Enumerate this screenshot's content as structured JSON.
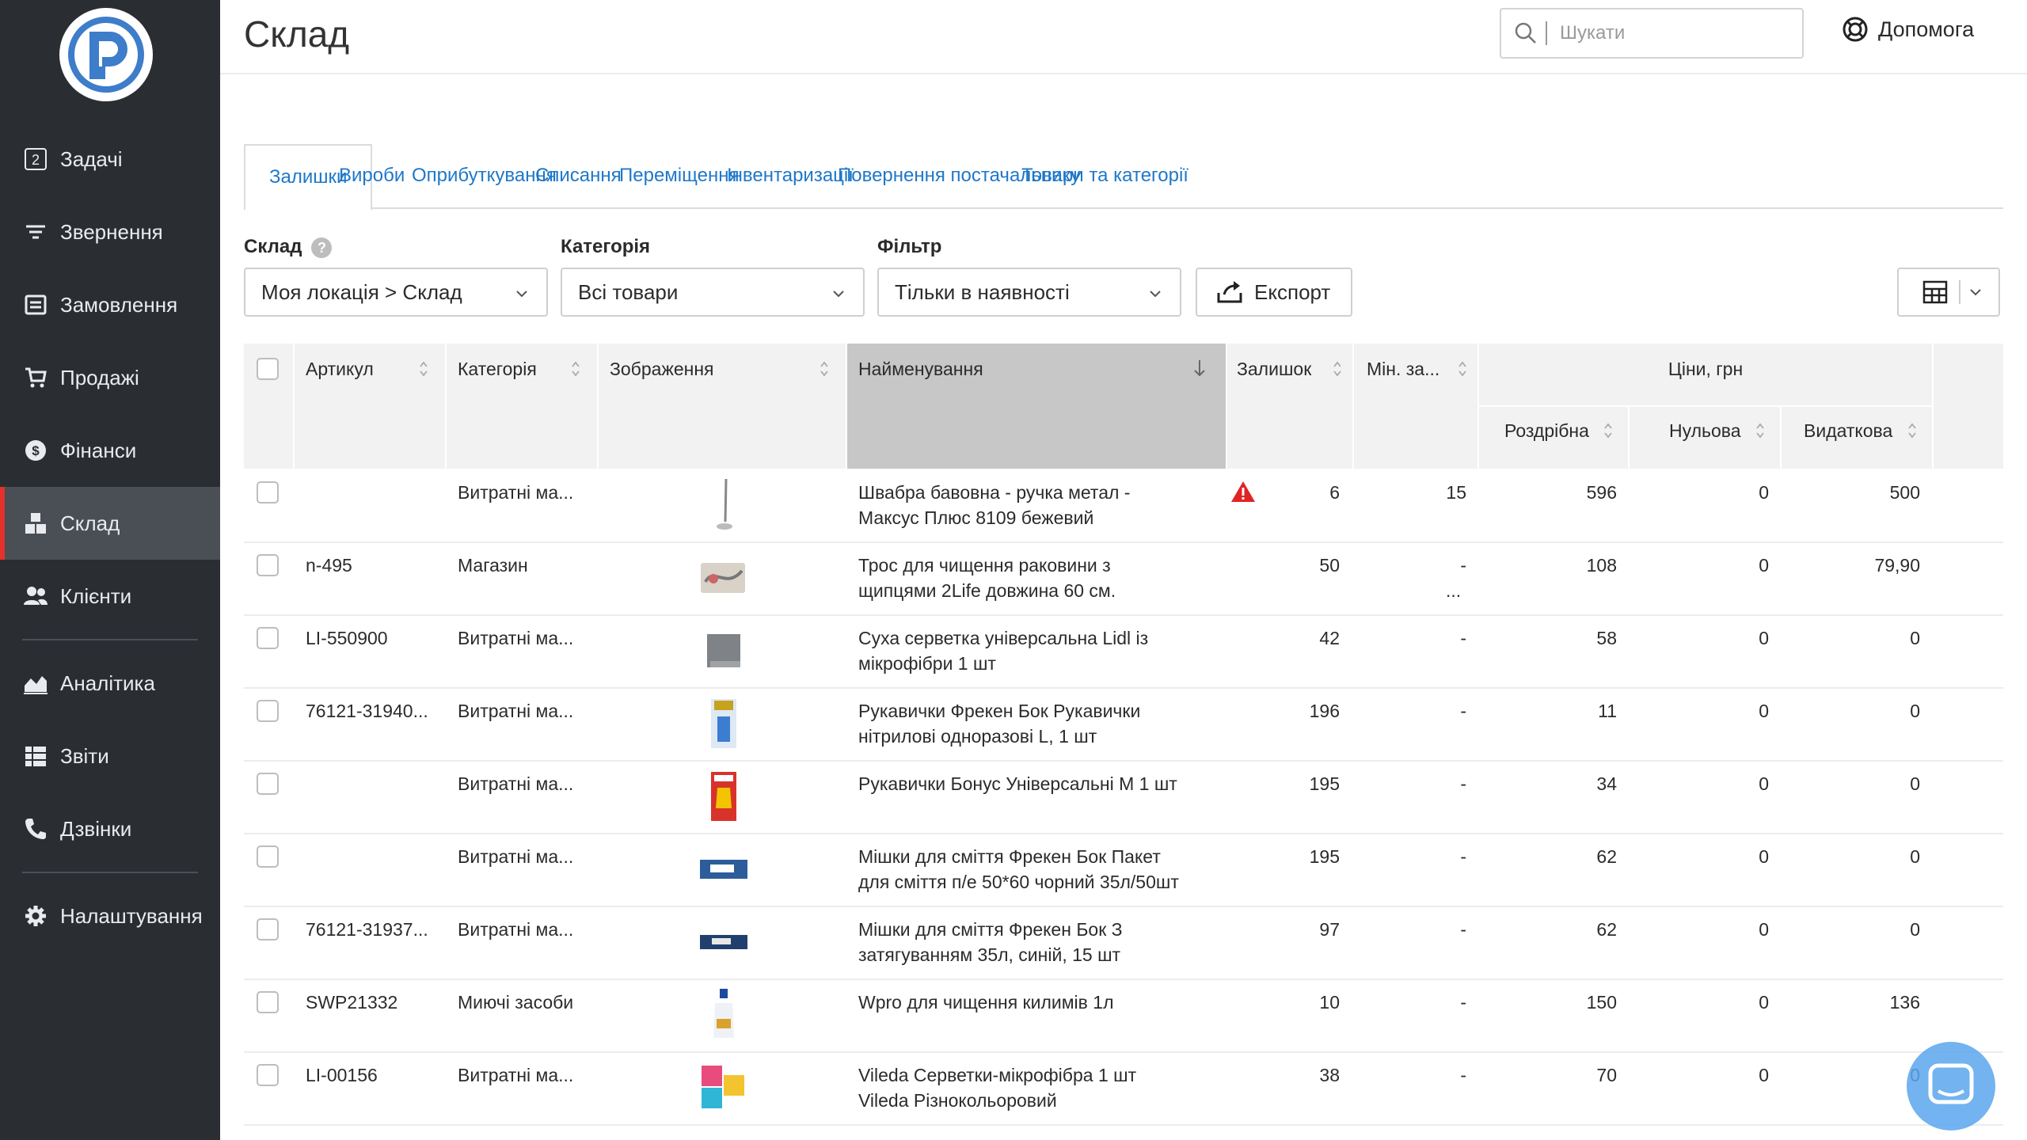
{
  "sidebar": {
    "items": [
      {
        "label": "Задачі",
        "icon": "tasks-badge-icon",
        "badge": "2"
      },
      {
        "label": "Звернення",
        "icon": "filter-lines-icon"
      },
      {
        "label": "Замовлення",
        "icon": "order-box-icon"
      },
      {
        "label": "Продажі",
        "icon": "cart-icon"
      },
      {
        "label": "Фінанси",
        "icon": "dollar-coin-icon"
      },
      {
        "label": "Склад",
        "icon": "warehouse-boxes-icon",
        "active": true
      },
      {
        "label": "Клієнти",
        "icon": "users-icon"
      },
      {
        "label": "Аналітика",
        "icon": "area-chart-icon"
      },
      {
        "label": "Звіти",
        "icon": "report-list-icon"
      },
      {
        "label": "Дзвінки",
        "icon": "phone-icon"
      },
      {
        "label": "Налаштування",
        "icon": "gear-icon"
      }
    ]
  },
  "header": {
    "title": "Склад",
    "search_placeholder": "Шукати",
    "help_label": "Допомога"
  },
  "tabs": [
    "Залишки",
    "Вироби",
    "Оприбуткування",
    "Списання",
    "Переміщення",
    "Інвентаризації",
    "Повернення постачальнику",
    "Товари та категорії"
  ],
  "filters": {
    "warehouse_label": "Склад",
    "warehouse_help": "?",
    "warehouse_value": "Моя локація > Склад",
    "category_label": "Категорія",
    "category_value": "Всі товари",
    "filter_label": "Фільтр",
    "filter_value": "Тільки в наявності",
    "export_label": "Експорт"
  },
  "table": {
    "headers": {
      "sku": "Артикул",
      "category": "Категорія",
      "image": "Зображення",
      "name": "Найменування",
      "stock": "Залишок",
      "min": "Мін. за...",
      "prices": "Ціни, грн",
      "retail": "Роздрібна",
      "zero": "Нульова",
      "expense": "Видаткова"
    },
    "rows": [
      {
        "sku": "",
        "category": "Витратні ма...",
        "name1": "Швабра бавовна - ручка метал -",
        "name2": "Максус Плюс 8109 бежевий",
        "stock": "6",
        "min": "15",
        "retail": "596",
        "zero": "0",
        "expense": "500",
        "warn": true,
        "img": "mop"
      },
      {
        "sku": "n-495",
        "category": "Магазин",
        "name1": "Трос для чищення раковини з",
        "name2": "щипцями 2Life довжина 60 см.",
        "more": "...",
        "stock": "50",
        "min": "-",
        "retail": "108",
        "zero": "0",
        "expense": "79,90",
        "img": "cable"
      },
      {
        "sku": "LI-550900",
        "category": "Витратні ма...",
        "name1": "Суха серветка універсальна Lidl із",
        "name2": "мікрофібри 1 шт",
        "stock": "42",
        "min": "-",
        "retail": "58",
        "zero": "0",
        "expense": "0",
        "img": "cloth"
      },
      {
        "sku": "76121-31940...",
        "category": "Витратні ма...",
        "name1": "Рукавички Фрекен Бок Рукавички",
        "name2": "нітрилові одноразові L, 1 шт",
        "stock": "196",
        "min": "-",
        "retail": "11",
        "zero": "0",
        "expense": "0",
        "img": "gloves-blue"
      },
      {
        "sku": "",
        "category": "Витратні ма...",
        "name1": "Рукавички Бонус Універсальні М 1 шт",
        "name2": "",
        "stock": "195",
        "min": "-",
        "retail": "34",
        "zero": "0",
        "expense": "0",
        "img": "gloves-red"
      },
      {
        "sku": "",
        "category": "Витратні ма...",
        "name1": "Мішки для сміття Фрекен Бок Пакет",
        "name2": "для сміття п/е 50*60 чорний 35л/50шт",
        "stock": "195",
        "min": "-",
        "retail": "62",
        "zero": "0",
        "expense": "0",
        "img": "bags"
      },
      {
        "sku": "76121-31937...",
        "category": "Витратні ма...",
        "name1": "Мішки для сміття Фрекен Бок З",
        "name2": "затягуванням 35л, синій, 15 шт",
        "stock": "97",
        "min": "-",
        "retail": "62",
        "zero": "0",
        "expense": "0",
        "img": "bags2"
      },
      {
        "sku": "SWP21332",
        "category": "Миючі засоби",
        "name1": "Wpro для чищення килимів 1л",
        "name2": "",
        "stock": "10",
        "min": "-",
        "retail": "150",
        "zero": "0",
        "expense": "136",
        "img": "bottle"
      },
      {
        "sku": "LI-00156",
        "category": "Витратні ма...",
        "name1": "Vileda Серветки-мікрофібра 1 шт",
        "name2": "Vileda Різнокольоровий",
        "stock": "38",
        "min": "-",
        "retail": "70",
        "zero": "0",
        "expense": "0",
        "img": "vileda"
      }
    ]
  },
  "colors": {
    "sidebar": "#2a2e33",
    "active_marker": "#e5312b",
    "link": "#1f78c8",
    "sorted_header": "#c7c7c7",
    "warning": "#e02424",
    "chat": "#5aa6ee"
  }
}
